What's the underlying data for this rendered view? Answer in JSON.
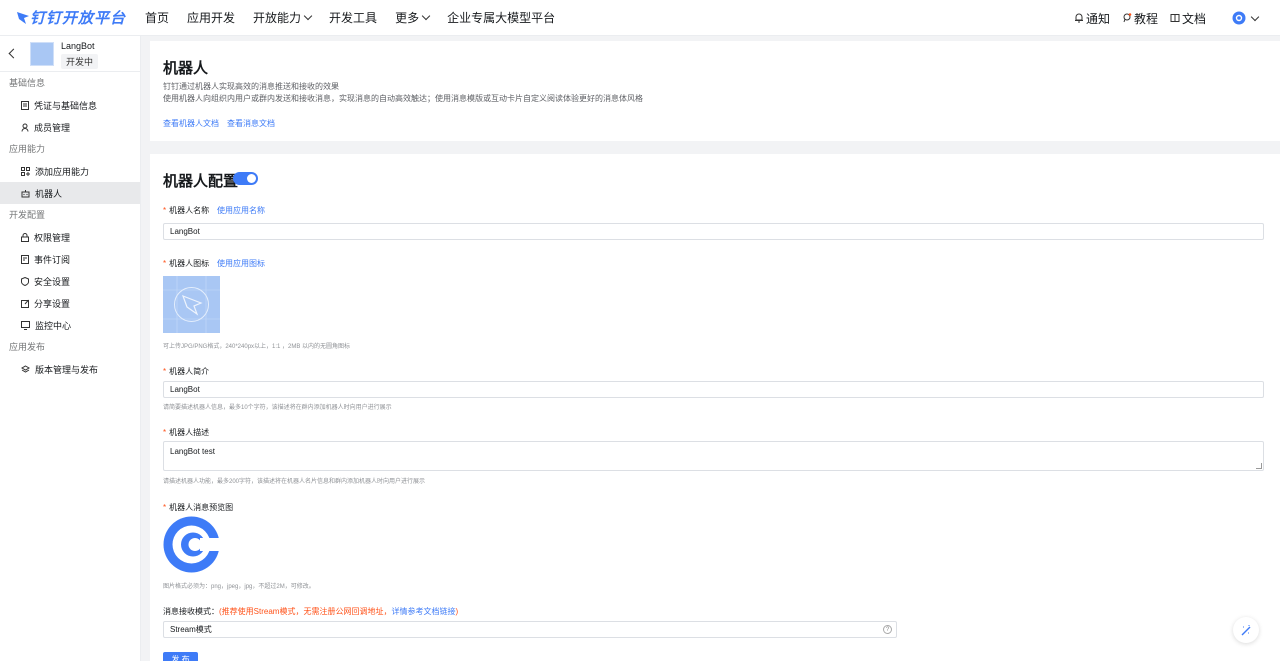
{
  "brand": {
    "logo_text": "钉钉开放平台",
    "accent": "#3e7bf7"
  },
  "topnav": {
    "items": [
      {
        "label": "首页"
      },
      {
        "label": "应用开发"
      },
      {
        "label": "开放能力"
      },
      {
        "label": "开发工具"
      },
      {
        "label": "更多"
      },
      {
        "label": "企业专属大模型平台"
      }
    ],
    "notify": "通知",
    "tutorial": "教程",
    "docs": "文档"
  },
  "app": {
    "name": "LangBot",
    "status": "开发中"
  },
  "sidebar": {
    "groups": [
      {
        "title": "基础信息",
        "items": [
          {
            "label": "凭证与基础信息",
            "icon": "document-icon"
          },
          {
            "label": "成员管理",
            "icon": "user-icon"
          }
        ]
      },
      {
        "title": "应用能力",
        "items": [
          {
            "label": "添加应用能力",
            "icon": "grid-add-icon"
          },
          {
            "label": "机器人",
            "icon": "robot-icon"
          }
        ]
      },
      {
        "title": "开发配置",
        "items": [
          {
            "label": "权限管理",
            "icon": "lock-icon"
          },
          {
            "label": "事件订阅",
            "icon": "event-icon"
          },
          {
            "label": "安全设置",
            "icon": "shield-icon"
          },
          {
            "label": "分享设置",
            "icon": "share-icon"
          },
          {
            "label": "监控中心",
            "icon": "monitor-icon"
          }
        ]
      },
      {
        "title": "应用发布",
        "items": [
          {
            "label": "版本管理与发布",
            "icon": "layers-icon"
          }
        ]
      }
    ],
    "active": "机器人"
  },
  "intro": {
    "title": "机器人",
    "desc1": "钉钉通过机器人实现高效的消息推送和接收的效果",
    "desc2": "使用机器人向组织内用户或群内发送和接收消息，实现消息的自动高效触达；使用消息模版或互动卡片自定义阅读体验更好的消息体风格",
    "link_robot_doc": "查看机器人文档",
    "link_message_doc": "查看消息文档"
  },
  "config": {
    "title": "机器人配置",
    "toggle_on": true,
    "name_label": "机器人名称",
    "use_app_name": "使用应用名称",
    "name_value": "LangBot",
    "icon_label": "机器人图标",
    "use_app_icon": "使用应用图标",
    "icon_hint": "可上传JPG/PNG格式，240*240px以上，1:1 ，2MB 以内的无圆角图标",
    "intro_label": "机器人简介",
    "intro_value": "LangBot",
    "intro_hint": "请简要描述机器人信息，最多10个字符，该描述将在群内添加机器人时向用户进行展示",
    "desc_label": "机器人描述",
    "desc_value": "LangBot test",
    "desc_hint": "请描述机器人功能，最多200字符，该描述将在机器人名片信息和群内添加机器人时向用户进行展示",
    "preview_label": "机器人消息预览图",
    "preview_hint": "图片格式必须为：png，jpeg，jpg，不超过2M，可修改。",
    "mode_label": "消息接收模式：",
    "mode_note": "(推荐使用Stream模式，无需注册公网回调地址，",
    "mode_link": "详情参考文档链接",
    "mode_note_end": ")",
    "mode_value": "Stream模式",
    "save_label": "发 布"
  }
}
